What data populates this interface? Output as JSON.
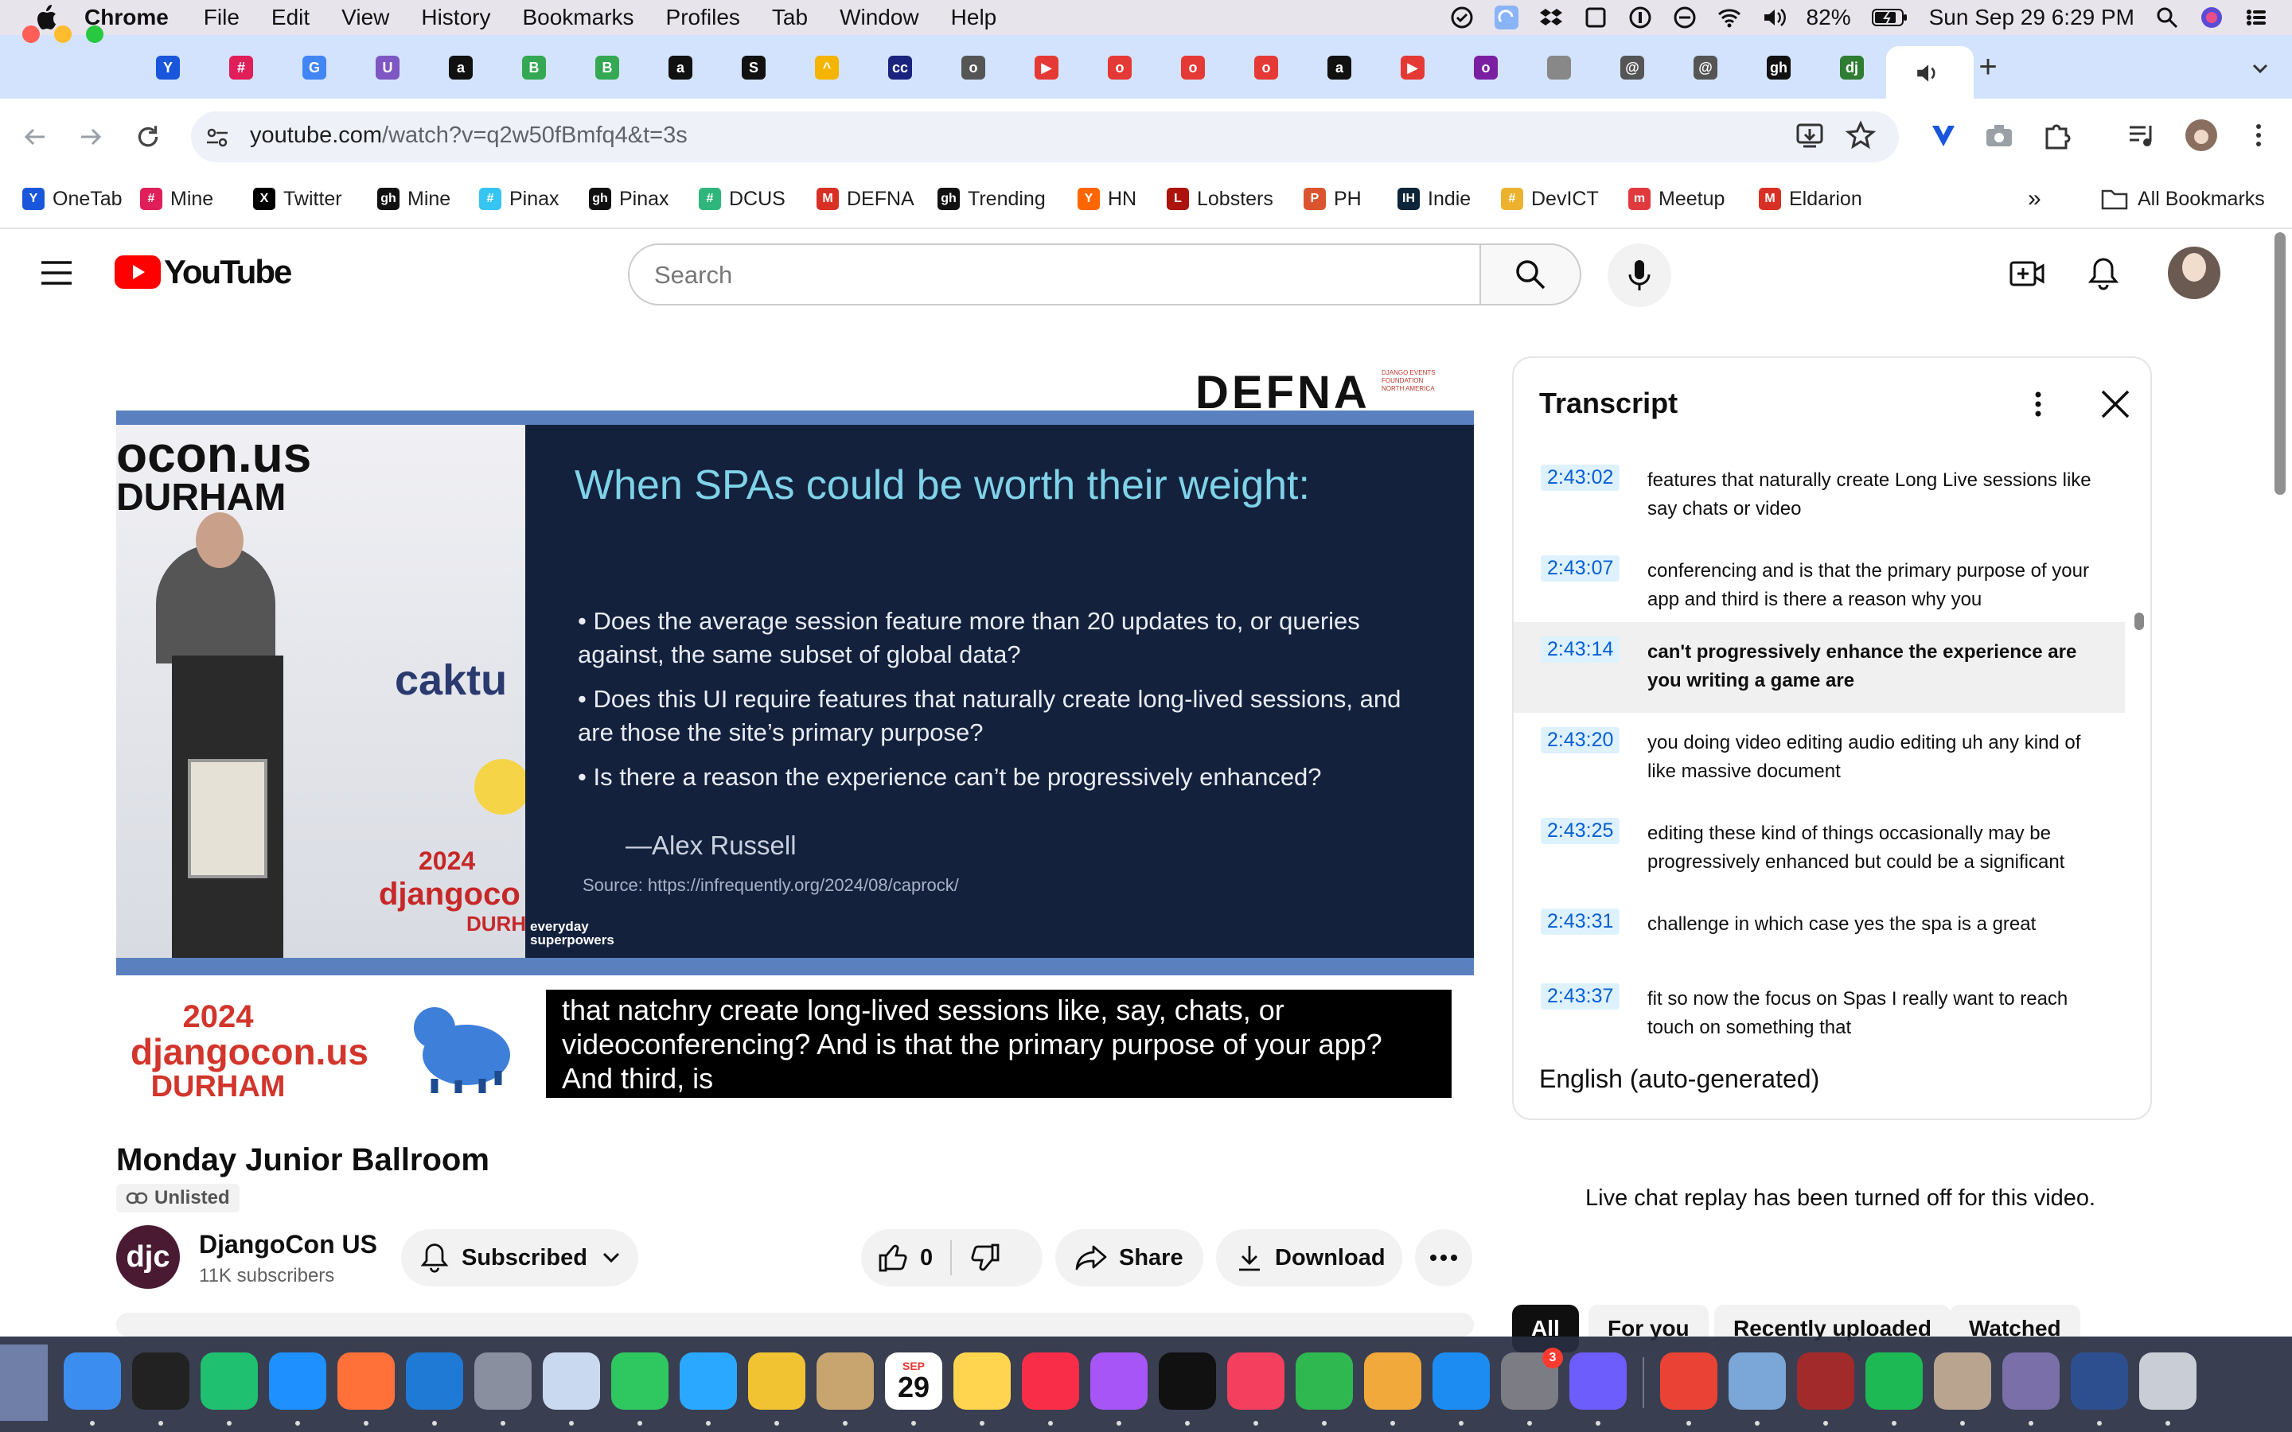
{
  "menubar": {
    "app": "Chrome",
    "items": [
      "File",
      "Edit",
      "View",
      "History",
      "Bookmarks",
      "Profiles",
      "Tab",
      "Window",
      "Help"
    ],
    "battery": "82%",
    "datetime": "Sun Sep 29  6:29 PM"
  },
  "tabs": {
    "favicons": [
      "Y",
      "#",
      "G",
      "U",
      "a",
      "B",
      "B",
      "a",
      "S",
      "^",
      "cc",
      "o",
      "▶",
      "o",
      "o",
      "o",
      "a",
      "▶",
      "o",
      "",
      "@",
      "@",
      "gh",
      "dj"
    ],
    "active_icon": "speaker-icon",
    "new_tab": "+"
  },
  "toolbar": {
    "url_host": "youtube.com",
    "url_path": "/watch?v=q2w50fBmfq4&t=3s"
  },
  "bookmarks": {
    "items": [
      {
        "label": "OneTab",
        "icon": "Y",
        "color": "#1a56db"
      },
      {
        "label": "Mine",
        "icon": "#",
        "color": "#e01e5a"
      },
      {
        "label": "Twitter",
        "icon": "X",
        "color": "#000000"
      },
      {
        "label": "Mine",
        "icon": "gh",
        "color": "#111111"
      },
      {
        "label": "Pinax",
        "icon": "#",
        "color": "#36c5f0"
      },
      {
        "label": "Pinax",
        "icon": "gh",
        "color": "#111111"
      },
      {
        "label": "DCUS",
        "icon": "#",
        "color": "#2eb67d"
      },
      {
        "label": "DEFNA",
        "icon": "M",
        "color": "#d93025"
      },
      {
        "label": "Trending",
        "icon": "gh",
        "color": "#111111"
      },
      {
        "label": "HN",
        "icon": "Y",
        "color": "#ff6600"
      },
      {
        "label": "Lobsters",
        "icon": "L",
        "color": "#ac130d"
      },
      {
        "label": "PH",
        "icon": "P",
        "color": "#da552f"
      },
      {
        "label": "Indie",
        "icon": "IH",
        "color": "#0e2439"
      },
      {
        "label": "DevICT",
        "icon": "#",
        "color": "#ecb22e"
      },
      {
        "label": "Meetup",
        "icon": "m",
        "color": "#e0393e"
      },
      {
        "label": "Eldarion",
        "icon": "M",
        "color": "#d93025"
      }
    ],
    "overflow": "»",
    "all_bookmarks": "All Bookmarks"
  },
  "youtube": {
    "logo_text": "YouTube",
    "search_placeholder": "Search"
  },
  "video": {
    "defna": "DEFNA",
    "defna_sub": "DJANGO EVENTS FOUNDATION NORTH AMERICA",
    "stage_text": {
      "con": "ocon.us",
      "durham": "DURHAM",
      "caktus": "caktu",
      "year": "2024",
      "djangoco": "djangoco",
      "durh": "DURH"
    },
    "slide_title": "When SPAs could be worth their weight:",
    "bullets": [
      "• Does the average session feature more than 20 updates to, or queries against, the same subset of global data?",
      "• Does this UI require features that naturally create long-lived sessions, and are those the site’s primary purpose?",
      "• Is there a reason the experience can’t be progressively enhanced?"
    ],
    "author": "—Alex Russell",
    "source": "Source: https://infrequently.org/2024/08/caprock/",
    "slide_logo": "everyday superpowers",
    "banner_year": "2024",
    "banner_name": "djangocon.us",
    "banner_city": "DURHAM",
    "caption": "that natchry create long-lived sessions like, say, chats, or videoconferencing? And is that the primary purpose of your app? And third, is"
  },
  "transcript": {
    "title": "Transcript",
    "language": "English (auto-generated)",
    "rows": [
      {
        "time": "2:43:02",
        "text": "features that naturally create Long Live sessions like say chats or video",
        "active": false
      },
      {
        "time": "2:43:07",
        "text": "conferencing and is that the primary purpose of your app and third is there a reason why you",
        "active": false
      },
      {
        "time": "2:43:14",
        "text": "can't progressively enhance the experience are you writing a game are",
        "active": true
      },
      {
        "time": "2:43:20",
        "text": "you doing video editing audio editing uh any kind of like massive document",
        "active": false
      },
      {
        "time": "2:43:25",
        "text": "editing these kind of things occasionally may be progressively enhanced but could be a significant",
        "active": false
      },
      {
        "time": "2:43:31",
        "text": "challenge in which case yes the spa is a great",
        "active": false
      },
      {
        "time": "2:43:37",
        "text": "fit so now the focus on Spas I really want to reach touch on something that",
        "active": false
      }
    ]
  },
  "details": {
    "title": "Monday Junior Ballroom",
    "unlisted": "Unlisted",
    "channel_initials": "djc",
    "channel_name": "DjangoCon US",
    "subscribers": "11K subscribers",
    "subscribed_label": "Subscribed",
    "likes": "0",
    "share_label": "Share",
    "download_label": "Download",
    "live_chat_notice": "Live chat replay has been turned off for this video."
  },
  "chips": [
    "All",
    "For you",
    "Recently uploaded",
    "Watched"
  ],
  "dock": {
    "calendar_month": "SEP",
    "calendar_day": "29",
    "badge": "3"
  }
}
